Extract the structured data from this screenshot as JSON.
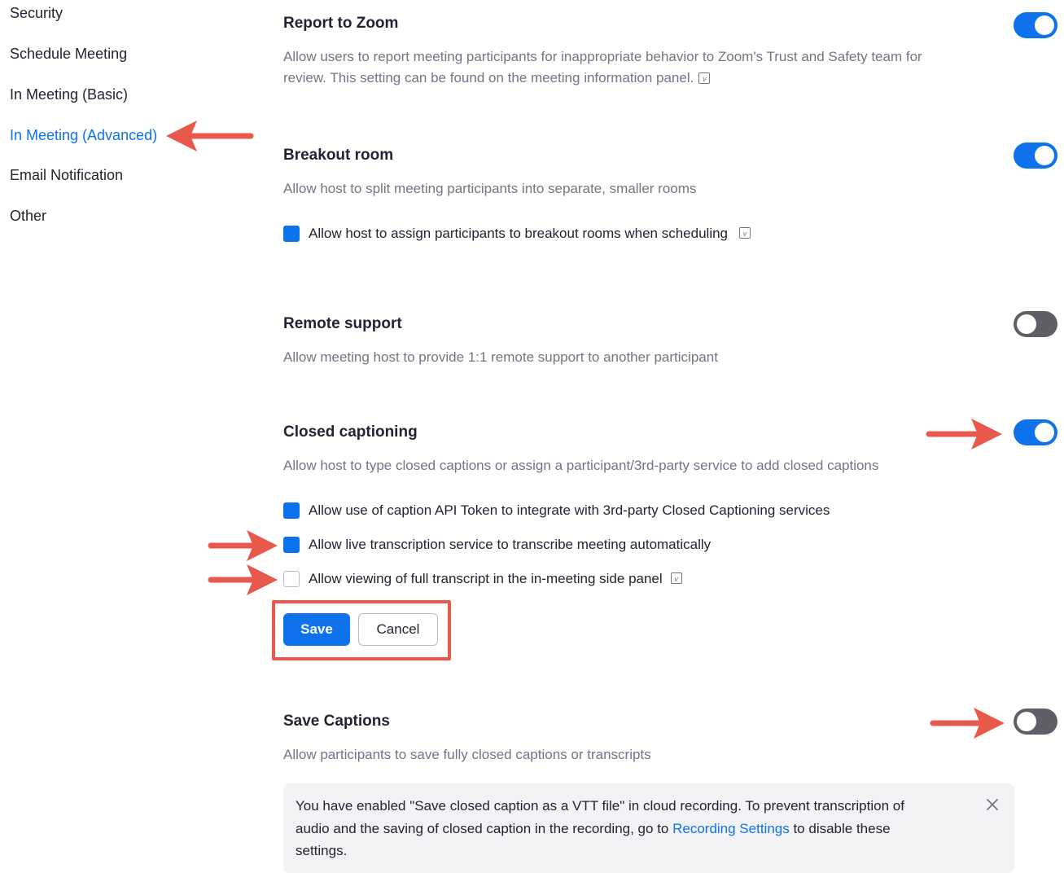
{
  "sidebar": {
    "items": [
      {
        "label": "Security"
      },
      {
        "label": "Schedule Meeting"
      },
      {
        "label": "In Meeting (Basic)"
      },
      {
        "label": "In Meeting (Advanced)",
        "active": true
      },
      {
        "label": "Email Notification"
      },
      {
        "label": "Other"
      }
    ]
  },
  "settings": {
    "report_to_zoom": {
      "title": "Report to Zoom",
      "description_line1": "Allow users to report meeting participants for inappropriate behavior to Zoom's Trust and Safety team for",
      "description_line2": "review. This setting can be found on the meeting information panel.",
      "enabled": true
    },
    "breakout_room": {
      "title": "Breakout room",
      "description": "Allow host to split meeting participants into separate, smaller rooms",
      "enabled": true,
      "options": [
        {
          "label": "Allow host to assign participants to breakout rooms when scheduling",
          "checked": true
        }
      ]
    },
    "remote_support": {
      "title": "Remote support",
      "description": "Allow meeting host to provide 1:1 remote support to another participant",
      "enabled": false
    },
    "closed_captioning": {
      "title": "Closed captioning",
      "description": "Allow host to type closed captions or assign a participant/3rd-party service to add closed captions",
      "enabled": true,
      "options": [
        {
          "label": "Allow use of caption API Token to integrate with 3rd-party Closed Captioning services",
          "checked": true
        },
        {
          "label": "Allow live transcription service to transcribe meeting automatically",
          "checked": true
        },
        {
          "label": "Allow viewing of full transcript in the in-meeting side panel",
          "checked": false
        }
      ],
      "save_label": "Save",
      "cancel_label": "Cancel"
    },
    "save_captions": {
      "title": "Save Captions",
      "description": "Allow participants to save fully closed captions or transcripts",
      "enabled": false,
      "notice": {
        "line1": "You have enabled \"Save closed caption as a VTT file\" in cloud recording. To prevent transcription of",
        "line2_before": "audio and the saving of closed caption in the recording, go to ",
        "link": "Recording Settings",
        "line2_after": " to disable these",
        "line3": "settings."
      }
    }
  },
  "colors": {
    "accent": "#0E72ED",
    "toggle_off": "#5E5E66",
    "annotation": "#E8584B",
    "notice_bg": "#F3F3F5"
  },
  "icons": [
    "info-icon",
    "close-icon",
    "annotation-arrow"
  ]
}
